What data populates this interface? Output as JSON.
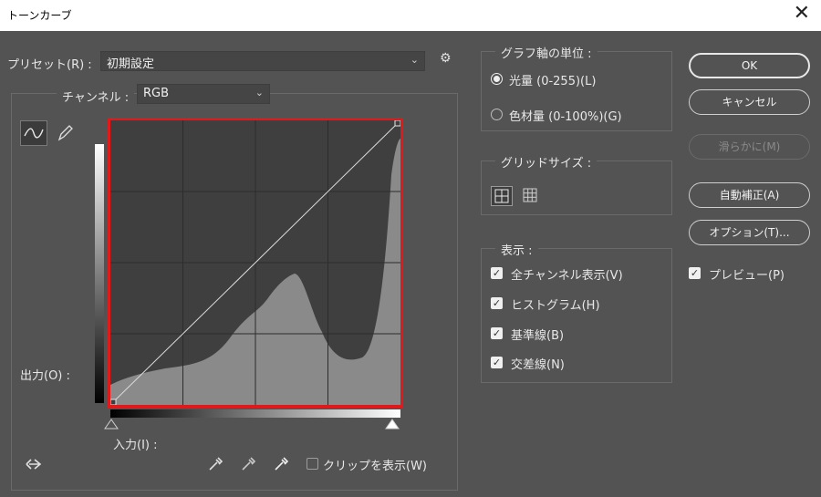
{
  "window": {
    "title": "トーンカーブ",
    "close_glyph": "✕"
  },
  "preset": {
    "label": "プリセット(R) :",
    "value": "初期設定",
    "gear_glyph": "⚙"
  },
  "channel": {
    "label": "チャンネル :",
    "value": "RGB"
  },
  "output_label": "出力(O) :",
  "input_label": "入力(I) :",
  "clip_label": "クリップを表示(W)",
  "graph_units": {
    "title": "グラフ軸の単位 :",
    "options": [
      {
        "label": "光量 (0-255)(L)",
        "checked": true
      },
      {
        "label": "色材量 (0-100%)(G)",
        "checked": false
      }
    ]
  },
  "grid_size": {
    "title": "グリッドサイズ :"
  },
  "display": {
    "title": "表示 :",
    "options": [
      {
        "label": "全チャンネル表示(V)",
        "checked": true
      },
      {
        "label": "ヒストグラム(H)",
        "checked": true
      },
      {
        "label": "基準線(B)",
        "checked": true
      },
      {
        "label": "交差線(N)",
        "checked": true
      }
    ]
  },
  "buttons": {
    "ok": "OK",
    "cancel": "キャンセル",
    "smooth": "滑らかに(M)",
    "auto": "自動補正(A)",
    "options": "オプション(T)..."
  },
  "preview": {
    "label": "プレビュー(P)",
    "checked": true
  },
  "colors": {
    "accent_red": "#e01a1a",
    "panel_bg": "#535353"
  }
}
